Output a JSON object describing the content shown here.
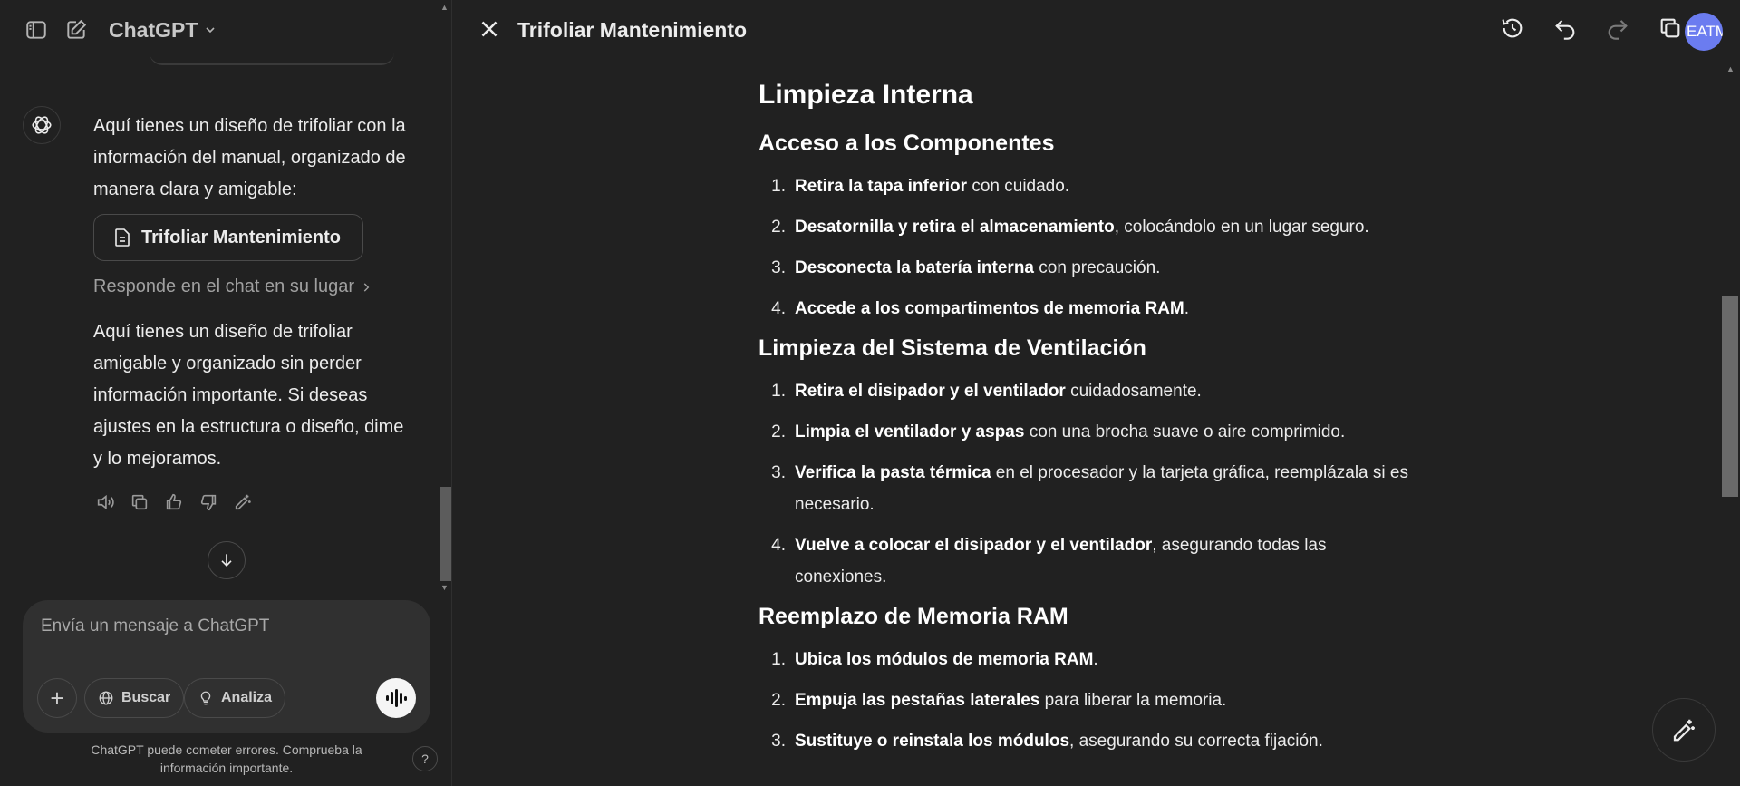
{
  "left_panel": {
    "header": {
      "model_name": "ChatGPT",
      "icons": [
        "sidebar-icon",
        "new-chat-icon",
        "chevron-down-icon"
      ]
    },
    "messages": [
      {
        "text": "Aquí tienes un diseño de trifoliar con la información del manual, organizado de manera clara y amigable:"
      },
      {
        "text": "Aquí tienes un diseño de trifoliar amigable y organizado sin perder información importante. Si deseas ajustes en la estructura o diseño, dime y lo mejoramos."
      }
    ],
    "doc_card": {
      "label": "Trifoliar Mantenimiento",
      "icon": "document-icon"
    },
    "respond_link": "Responde en el chat en su lugar",
    "message_actions": [
      "speaker-icon",
      "copy-icon",
      "thumbs-up-icon",
      "thumbs-down-icon",
      "edit-magic-icon"
    ],
    "composer": {
      "placeholder": "Envía un mensaje a ChatGPT",
      "buttons": {
        "add": "+",
        "search": "Buscar",
        "analyze": "Analiza"
      }
    },
    "disclaimer": "ChatGPT puede cometer errores. Comprueba la información importante.",
    "help": "?"
  },
  "right_panel": {
    "title": "Trifoliar Mantenimiento",
    "user_initials": "EATM",
    "toolbar_icons": [
      "history-icon",
      "undo-icon",
      "redo-icon",
      "copy-icon"
    ],
    "document": {
      "heading": "Limpieza Interna",
      "sections": [
        {
          "title": "Acceso a los Componentes",
          "items": [
            {
              "bold": "Retira la tapa inferior",
              "rest": " con cuidado."
            },
            {
              "bold": "Desatornilla y retira el almacenamiento",
              "rest": ", colocándolo en un lugar seguro."
            },
            {
              "bold": "Desconecta la batería interna",
              "rest": " con precaución."
            },
            {
              "bold": "Accede a los compartimentos de memoria RAM",
              "rest": "."
            }
          ]
        },
        {
          "title": "Limpieza del Sistema de Ventilación",
          "items": [
            {
              "bold": "Retira el disipador y el ventilador",
              "rest": " cuidadosamente."
            },
            {
              "bold": "Limpia el ventilador y aspas",
              "rest": " con una brocha suave o aire comprimido."
            },
            {
              "bold": "Verifica la pasta térmica",
              "rest": " en el procesador y la tarjeta gráfica, reemplázala si es necesario."
            },
            {
              "bold": "Vuelve a colocar el disipador y el ventilador",
              "rest": ", asegurando todas las conexiones."
            }
          ]
        },
        {
          "title": "Reemplazo de Memoria RAM",
          "items": [
            {
              "bold": "Ubica los módulos de memoria RAM",
              "rest": "."
            },
            {
              "bold": "Empuja las pestañas laterales",
              "rest": " para liberar la memoria."
            },
            {
              "bold": "Sustituye o reinstala los módulos",
              "rest": ", asegurando su correcta fijación."
            }
          ]
        }
      ]
    }
  }
}
